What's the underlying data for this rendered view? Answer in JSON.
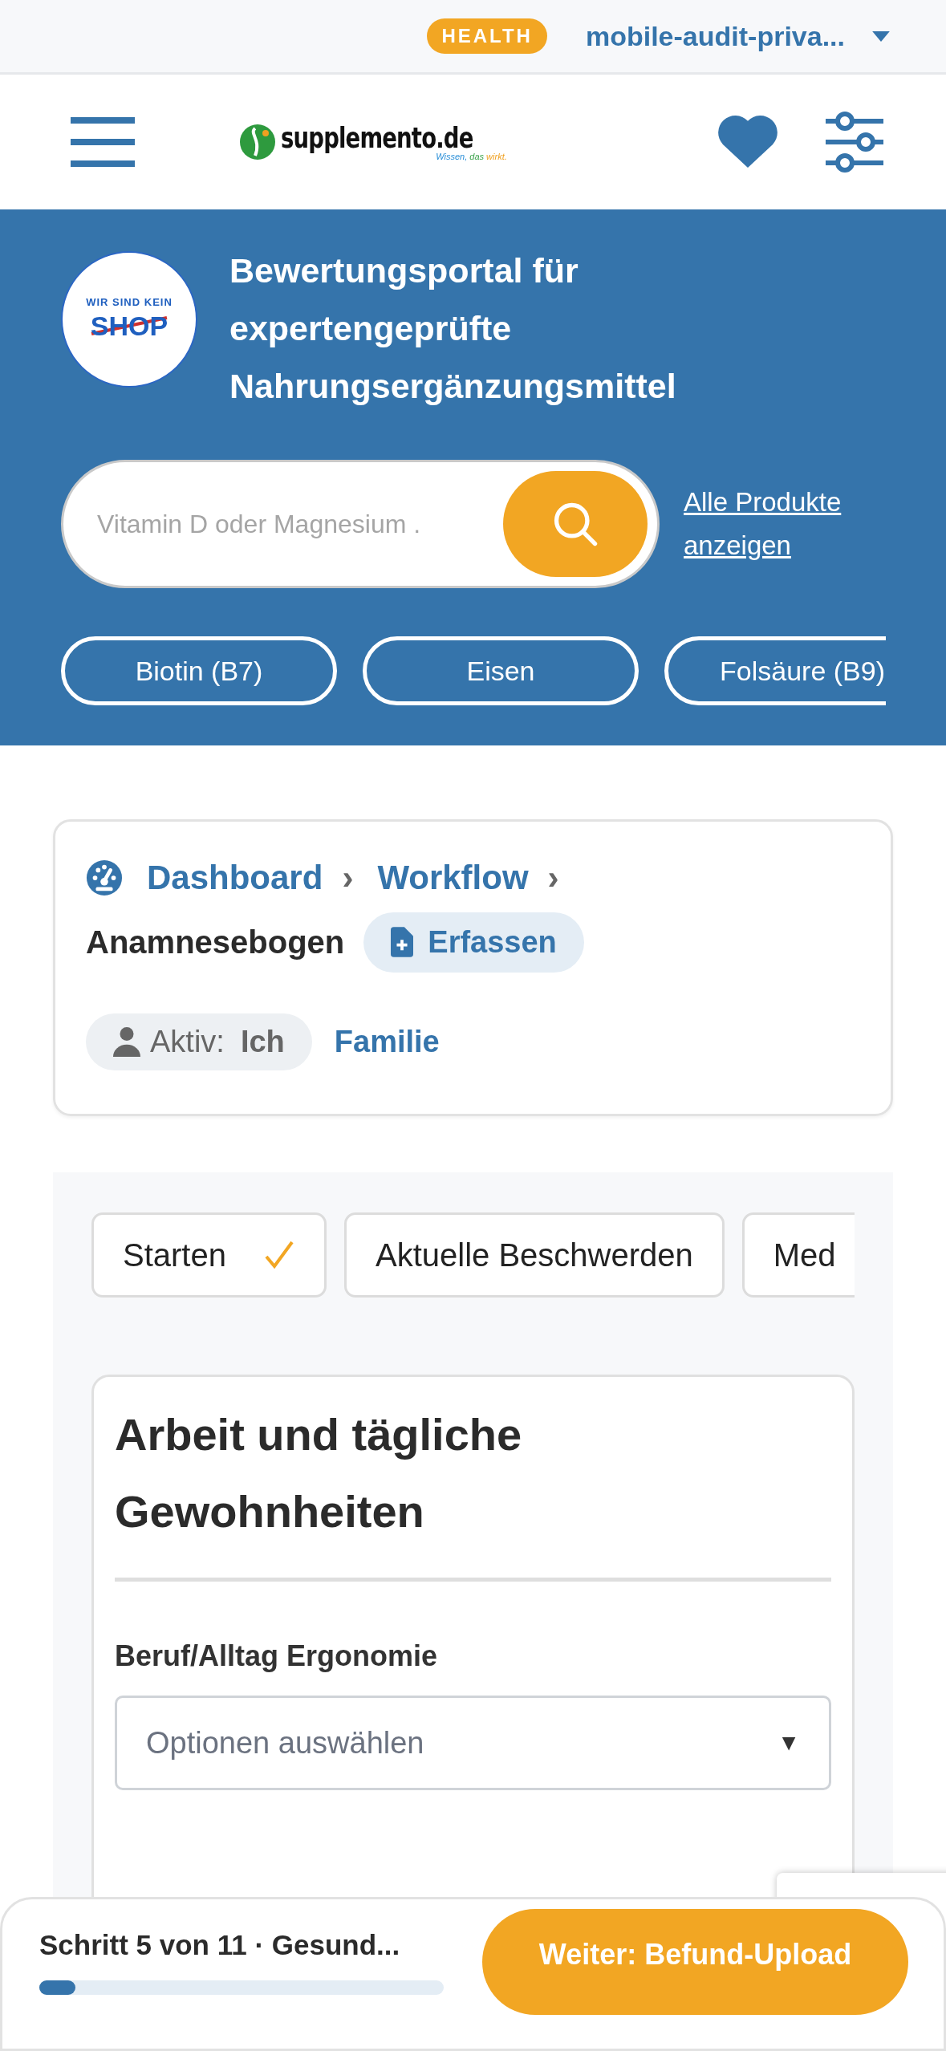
{
  "top_bar": {
    "badge": "HEALTH",
    "account": "mobile-audit-priva..."
  },
  "header": {
    "logo": {
      "name": "supplemento.de",
      "tagline": [
        {
          "text": "Wissen,",
          "color": "#2a8fd8"
        },
        {
          "text": "das",
          "color": "#3aa24a"
        },
        {
          "text": "wirkt.",
          "color": "#f0a020"
        }
      ]
    }
  },
  "hero": {
    "seal": {
      "top": "WIR SIND KEIN",
      "word": "SHOP"
    },
    "title": "Bewertungsportal für expertengeprüfte Nahrungsergänzungsmittel",
    "search": {
      "placeholder": "Vitamin D oder Magnesium ."
    },
    "all_link": "Alle Produkte anzeigen",
    "chips": [
      "Biotin (B7)",
      "Eisen",
      "Folsäure (B9)"
    ]
  },
  "breadcrumb": {
    "items": [
      "Dashboard",
      "Workflow"
    ],
    "separator": "›",
    "page": "Anamnesebogen",
    "action": "Erfassen",
    "profiles": [
      {
        "prefix": "Aktiv:",
        "label": "Ich",
        "selected": true
      },
      {
        "label": "Familie",
        "selected": false
      }
    ]
  },
  "steps": [
    {
      "label": "Starten",
      "done": true
    },
    {
      "label": "Aktuelle Beschwerden",
      "done": false
    },
    {
      "label": "Med",
      "done": false
    }
  ],
  "section": {
    "title": "Arbeit und tägliche Gewohnheiten",
    "fields": [
      {
        "label": "Beruf/Alltag Ergonomie",
        "placeholder": "Optionen auswählen",
        "caret": "▼"
      }
    ]
  },
  "footer": {
    "progress_text": "Schritt 5 von 11 · Gesund...",
    "level": 0.09,
    "button": "Weiter: Befund-Upload"
  }
}
